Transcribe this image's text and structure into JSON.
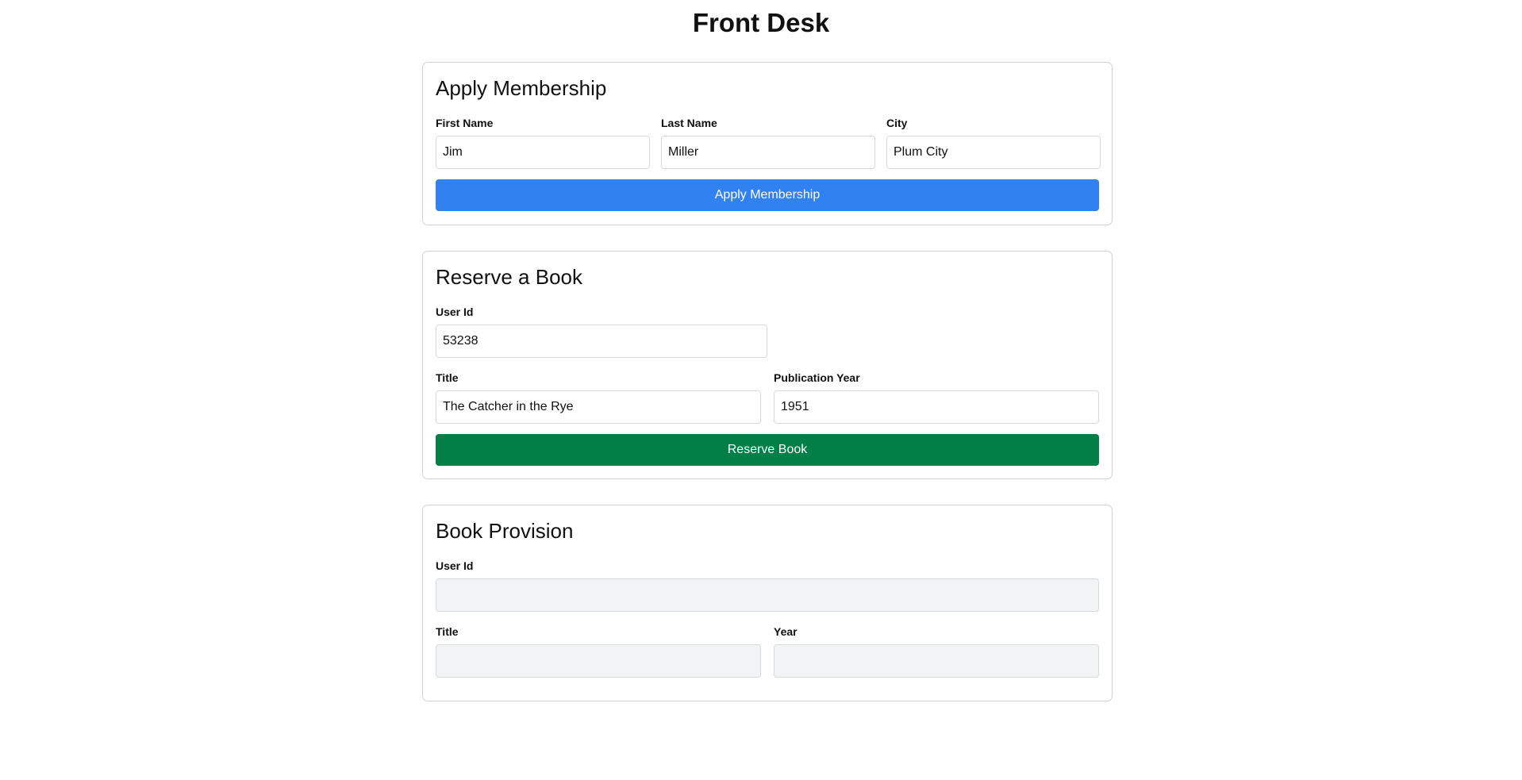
{
  "page": {
    "title": "Front Desk"
  },
  "membership": {
    "title": "Apply Membership",
    "first_name": {
      "label": "First Name",
      "value": "Jim"
    },
    "last_name": {
      "label": "Last Name",
      "value": "Miller"
    },
    "city": {
      "label": "City",
      "value": "Plum City"
    },
    "button_label": "Apply Membership",
    "button_color": "#3182f0"
  },
  "reserve": {
    "title": "Reserve a Book",
    "user_id": {
      "label": "User Id",
      "value": "53238"
    },
    "book_title": {
      "label": "Title",
      "value": "The Catcher in the Rye"
    },
    "publication_year": {
      "label": "Publication Year",
      "value": "1951"
    },
    "button_label": "Reserve Book",
    "button_color": "#017f47"
  },
  "provision": {
    "title": "Book Provision",
    "user_id": {
      "label": "User Id",
      "value": ""
    },
    "book_title": {
      "label": "Title",
      "value": ""
    },
    "year": {
      "label": "Year",
      "value": ""
    }
  }
}
